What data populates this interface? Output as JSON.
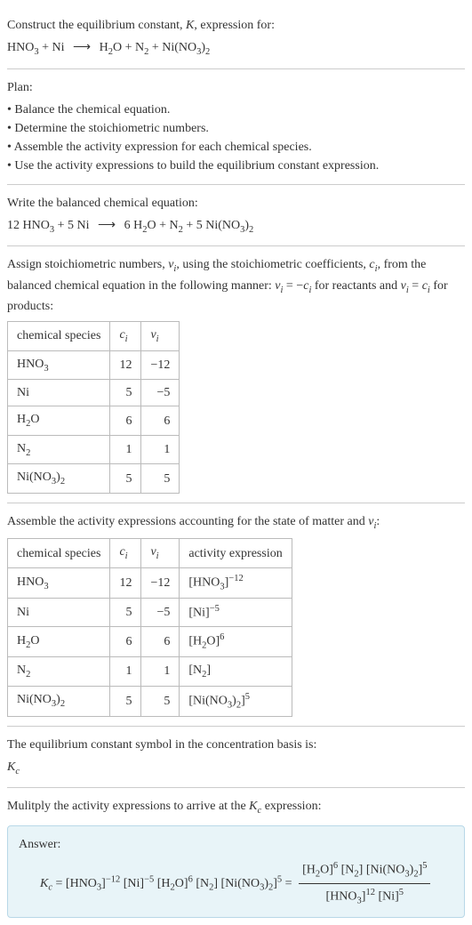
{
  "header": {
    "title_pre": "Construct the equilibrium constant, ",
    "title_k": "K",
    "title_post": ", expression for:",
    "reaction_lhs_1": "HNO",
    "reaction_lhs_1_sub": "3",
    "reaction_plus1": " + Ni ",
    "reaction_arrow": "⟶",
    "reaction_rhs_1": " H",
    "reaction_rhs_1_sub": "2",
    "reaction_rhs_2": "O + N",
    "reaction_rhs_2_sub": "2",
    "reaction_rhs_3": " + Ni(NO",
    "reaction_rhs_3_sub": "3",
    "reaction_rhs_4": ")",
    "reaction_rhs_4_sub": "2"
  },
  "plan": {
    "label": "Plan:",
    "b1": "• Balance the chemical equation.",
    "b2": "• Determine the stoichiometric numbers.",
    "b3": "• Assemble the activity expression for each chemical species.",
    "b4": "• Use the activity expressions to build the equilibrium constant expression."
  },
  "balanced": {
    "label": "Write the balanced chemical equation:",
    "lhs1": "12 HNO",
    "lhs1_sub": "3",
    "lhs2": " + 5 Ni ",
    "arrow": "⟶",
    "rhs1": " 6 H",
    "rhs1_sub": "2",
    "rhs2": "O + N",
    "rhs2_sub": "2",
    "rhs3": " + 5 Ni(NO",
    "rhs3_sub": "3",
    "rhs4": ")",
    "rhs4_sub": "2"
  },
  "stoich": {
    "text1": "Assign stoichiometric numbers, ",
    "nu": "ν",
    "sub_i": "i",
    "text2": ", using the stoichiometric coefficients, ",
    "c": "c",
    "text3": ", from the balanced chemical equation in the following manner: ",
    "eq1a": "ν",
    "eq1b": " = −",
    "eq1c": "c",
    "text4": " for reactants and ",
    "eq2a": "ν",
    "eq2b": " = ",
    "eq2c": "c",
    "text5": " for products:",
    "th1": "chemical species",
    "th2_c": "c",
    "th2_i": "i",
    "th3_n": "ν",
    "th3_i": "i",
    "rows": [
      {
        "sp_a": "HNO",
        "sp_sub": "3",
        "sp_b": "",
        "c": "12",
        "v": "−12"
      },
      {
        "sp_a": "Ni",
        "sp_sub": "",
        "sp_b": "",
        "c": "5",
        "v": "−5"
      },
      {
        "sp_a": "H",
        "sp_sub": "2",
        "sp_b": "O",
        "c": "6",
        "v": "6"
      },
      {
        "sp_a": "N",
        "sp_sub": "2",
        "sp_b": "",
        "c": "1",
        "v": "1"
      },
      {
        "sp_a": "Ni(NO",
        "sp_sub": "3",
        "sp_b": ")",
        "sp_sub2": "2",
        "c": "5",
        "v": "5"
      }
    ]
  },
  "activity": {
    "text1": "Assemble the activity expressions accounting for the state of matter and ",
    "nu": "ν",
    "sub_i": "i",
    "text2": ":",
    "th1": "chemical species",
    "th2_c": "c",
    "th2_i": "i",
    "th3_n": "ν",
    "th3_i": "i",
    "th4": "activity expression",
    "rows": [
      {
        "sp_a": "HNO",
        "sp_sub": "3",
        "sp_b": "",
        "c": "12",
        "v": "−12",
        "ae_a": "[HNO",
        "ae_sub": "3",
        "ae_b": "]",
        "ae_sup": "−12"
      },
      {
        "sp_a": "Ni",
        "sp_sub": "",
        "sp_b": "",
        "c": "5",
        "v": "−5",
        "ae_a": "[Ni]",
        "ae_sub": "",
        "ae_b": "",
        "ae_sup": "−5"
      },
      {
        "sp_a": "H",
        "sp_sub": "2",
        "sp_b": "O",
        "c": "6",
        "v": "6",
        "ae_a": "[H",
        "ae_sub": "2",
        "ae_b": "O]",
        "ae_sup": "6"
      },
      {
        "sp_a": "N",
        "sp_sub": "2",
        "sp_b": "",
        "c": "1",
        "v": "1",
        "ae_a": "[N",
        "ae_sub": "2",
        "ae_b": "]",
        "ae_sup": ""
      },
      {
        "sp_a": "Ni(NO",
        "sp_sub": "3",
        "sp_b": ")",
        "sp_sub2": "2",
        "c": "5",
        "v": "5",
        "ae_a": "[Ni(NO",
        "ae_sub": "3",
        "ae_b": ")",
        "ae_sub2": "2",
        "ae_c": "]",
        "ae_sup": "5"
      }
    ]
  },
  "symbol": {
    "text": "The equilibrium constant symbol in the concentration basis is:",
    "k": "K",
    "c": "c"
  },
  "multiply": {
    "text1": "Mulitply the activity expressions to arrive at the ",
    "k": "K",
    "c": "c",
    "text2": " expression:"
  },
  "answer": {
    "label": "Answer:",
    "k": "K",
    "c": "c",
    "eq": " = ",
    "t1_a": "[HNO",
    "t1_sub": "3",
    "t1_b": "]",
    "t1_sup": "−12",
    "t2_a": " [Ni]",
    "t2_sup": "−5",
    "t3_a": " [H",
    "t3_sub": "2",
    "t3_b": "O]",
    "t3_sup": "6",
    "t4_a": " [N",
    "t4_sub": "2",
    "t4_b": "]",
    "t5_a": " [Ni(NO",
    "t5_sub": "3",
    "t5_b": ")",
    "t5_sub2": "2",
    "t5_c": "]",
    "t5_sup": "5",
    "eq2": " = ",
    "num1_a": "[H",
    "num1_sub": "2",
    "num1_b": "O]",
    "num1_sup": "6",
    "num2_a": " [N",
    "num2_sub": "2",
    "num2_b": "]",
    "num3_a": " [Ni(NO",
    "num3_sub": "3",
    "num3_b": ")",
    "num3_sub2": "2",
    "num3_c": "]",
    "num3_sup": "5",
    "den1_a": "[HNO",
    "den1_sub": "3",
    "den1_b": "]",
    "den1_sup": "12",
    "den2_a": " [Ni]",
    "den2_sup": "5"
  }
}
